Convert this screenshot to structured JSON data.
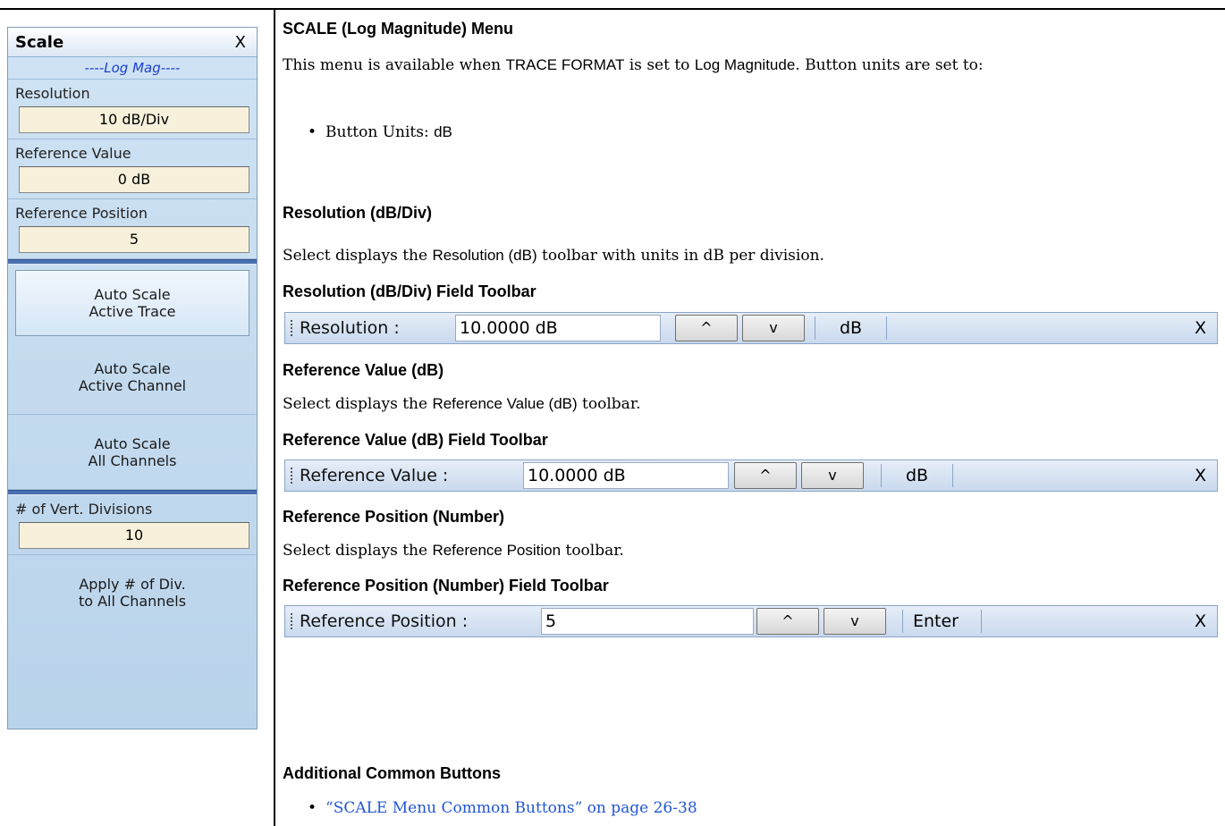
{
  "menu": {
    "title": "Scale",
    "close": "X",
    "subtitle": "----Log Mag----",
    "fields": [
      {
        "label": "Resolution",
        "value": "10  dB/Div"
      },
      {
        "label": "Reference Value",
        "value": "0  dB"
      },
      {
        "label": "Reference Position",
        "value": "5"
      }
    ],
    "auto_buttons": [
      {
        "line1": "Auto Scale",
        "line2": "Active Trace"
      },
      {
        "line1": "Auto Scale",
        "line2": "Active Channel"
      },
      {
        "line1": "Auto Scale",
        "line2": "All Channels"
      }
    ],
    "divisions": {
      "label": "# of Vert. Divisions",
      "value": "10"
    },
    "apply_button": {
      "line1": "Apply # of Div.",
      "line2": "to All Channels"
    }
  },
  "doc": {
    "heading": "SCALE (Log Magnitude) Menu",
    "intro_pre": "This menu is available when ",
    "intro_trace_format": "TRACE FORMAT",
    "intro_mid": " is set to ",
    "intro_logmag": "Log Magnitude",
    "intro_post": ". Button units are set to:",
    "bullet_pre": "Button Units: ",
    "bullet_unit": "dB",
    "sections": [
      {
        "heading": "Resolution (dB/Div)",
        "text_pre": "Select displays the ",
        "text_name": "Resolution (dB)",
        "text_post": " toolbar with units in dB per division.",
        "toolbar_heading": "Resolution (dB/Div) Field Toolbar"
      },
      {
        "heading": "Reference Value (dB)",
        "text_pre": "Select displays the ",
        "text_name": "Reference Value (dB)",
        "text_post": " toolbar.",
        "toolbar_heading": "Reference Value (dB) Field Toolbar"
      },
      {
        "heading": "Reference Position (Number)",
        "text_pre": "Select displays the ",
        "text_name": "Reference Position",
        "text_post": " toolbar.",
        "toolbar_heading": "Reference Position (Number) Field Toolbar"
      }
    ],
    "additional_heading": "Additional Common Buttons",
    "link_text": "“SCALE Menu Common Buttons” on page 26-38"
  },
  "toolbars": [
    {
      "label": "Resolution  :",
      "value": "10.0000  dB",
      "up": "^",
      "down": "v",
      "unit": "dB",
      "close": "X"
    },
    {
      "label": "Reference Value  :",
      "value": "10.0000  dB",
      "up": "^",
      "down": "v",
      "unit": "dB",
      "close": "X"
    },
    {
      "label": "Reference Position  :",
      "value": "5",
      "up": "^",
      "down": "v",
      "unit": "Enter",
      "close": "X"
    }
  ]
}
